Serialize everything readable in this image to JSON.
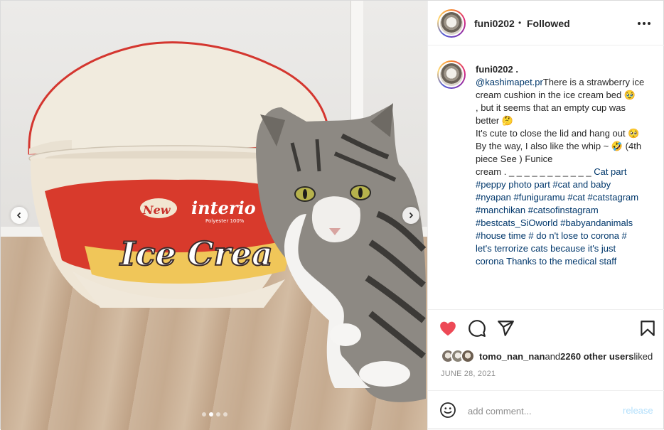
{
  "post": {
    "username": "funi0202",
    "separator": "•",
    "follow_status": "Followed",
    "more_icon": "more-horizontal-icon"
  },
  "caption": {
    "username": "funi0202 .",
    "lines": [
      {
        "mention": "@kashimapet.pr",
        "text": "There is a strawberry ice"
      },
      {
        "text": "cream cushion in the ice cream bed 🥹"
      },
      {
        "text": ", but it seems that an empty cup was"
      },
      {
        "text": "better 🤔"
      },
      {
        "text": "It's cute to close the lid and hang out 🥺"
      },
      {
        "text": "By the way, I also like the whip ~ 🤣 (4th"
      },
      {
        "text": "piece See ) Funice"
      },
      {
        "text": "cream . _ _ _ _ _ _ _ _ _ _ _ ",
        "link": "Cat part"
      }
    ],
    "hashtag_lines": [
      "#peppy photo part #cat and baby",
      "#nyapan #funiguramu #cat #catstagram",
      "#manchikan #catsofinstagram",
      "#bestcats_SiOworld #babyandanimals",
      "#house time # do n't lose to corona #",
      "let's terrorize cats because it's just",
      "corona Thanks to the medical staff"
    ]
  },
  "media": {
    "carousel_total": 4,
    "carousel_active": 2,
    "prev_icon": "chevron-left-icon",
    "next_icon": "chevron-right-icon"
  },
  "actions": {
    "like_icon": "heart-filled-icon",
    "comment_icon": "comment-bubble-icon",
    "share_icon": "paper-plane-icon",
    "save_icon": "bookmark-icon",
    "like_color": "#ed4956"
  },
  "likes": {
    "user": "tomo_nan_nan",
    "and_text": "and",
    "count_text": "2260 other users",
    "suffix": "liked"
  },
  "date": "JUNE 28, 2021",
  "comment_box": {
    "placeholder": "add comment...",
    "post_label": "release",
    "emoji_icon": "smiley-icon"
  },
  "colors": {
    "link": "#00376b",
    "muted": "#8e8e8e",
    "release_disabled": "#b2dffc"
  }
}
